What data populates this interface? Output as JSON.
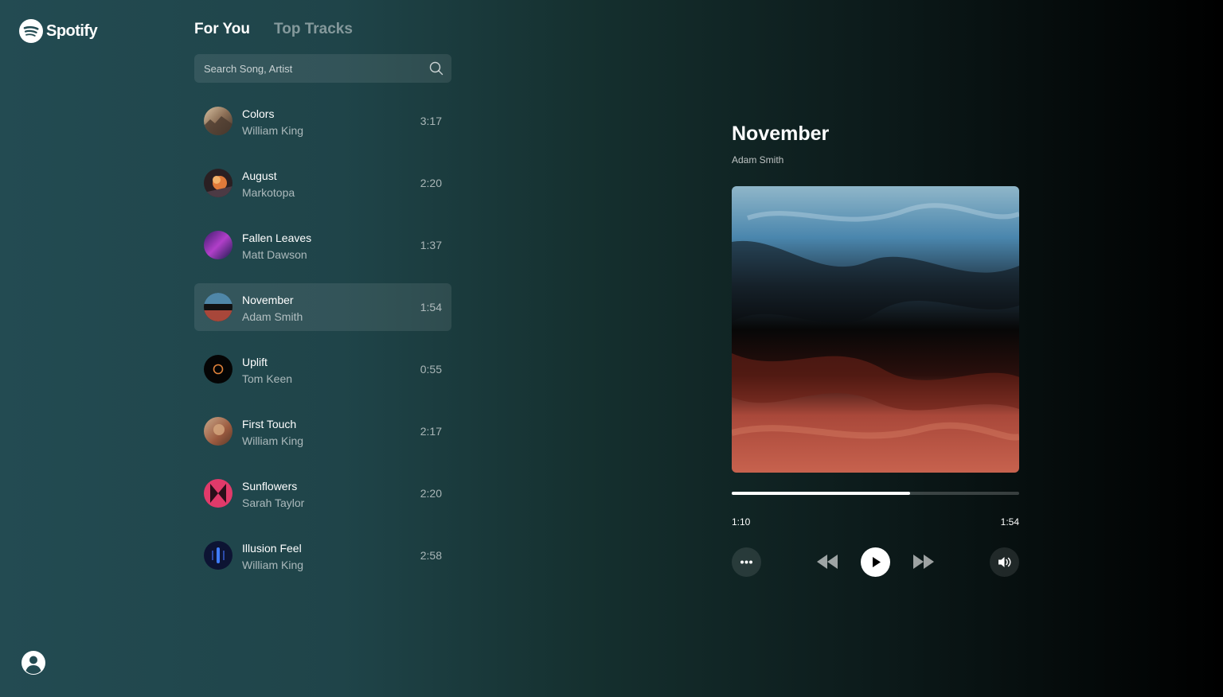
{
  "brand": {
    "name": "Spotify"
  },
  "tabs": [
    {
      "label": "For You",
      "active": true
    },
    {
      "label": "Top Tracks",
      "active": false
    }
  ],
  "search": {
    "placeholder": "Search Song, Artist",
    "value": ""
  },
  "tracks": [
    {
      "title": "Colors",
      "artist": "William King",
      "duration": "3:17",
      "thumb": "warm-landscape",
      "active": false
    },
    {
      "title": "August",
      "artist": "Markotopa",
      "duration": "2:20",
      "thumb": "orange-burst",
      "active": false
    },
    {
      "title": "Fallen Leaves",
      "artist": "Matt Dawson",
      "duration": "1:37",
      "thumb": "purple-gradient",
      "active": false
    },
    {
      "title": "November",
      "artist": "Adam Smith",
      "duration": "1:54",
      "thumb": "blue-red-fluid",
      "active": true
    },
    {
      "title": "Uplift",
      "artist": "Tom Keen",
      "duration": "0:55",
      "thumb": "black-orange-ring",
      "active": false
    },
    {
      "title": "First Touch",
      "artist": "William King",
      "duration": "2:17",
      "thumb": "warm-portrait",
      "active": false
    },
    {
      "title": "Sunflowers",
      "artist": "Sarah Taylor",
      "duration": "2:20",
      "thumb": "pink-red-shape",
      "active": false
    },
    {
      "title": "Illusion Feel",
      "artist": "William King",
      "duration": "2:58",
      "thumb": "blue-neon",
      "active": false
    }
  ],
  "now_playing": {
    "title": "November",
    "artist": "Adam Smith",
    "elapsed": "1:10",
    "total": "1:54",
    "progress": 0.62
  },
  "controls": {
    "icons": [
      "more-icon",
      "previous-icon",
      "play-icon",
      "next-icon",
      "volume-icon"
    ]
  },
  "colors": {
    "accent": "#ffffff",
    "active_row": "rgba(255,255,255,0.09)",
    "muted_text": "rgba(255,255,255,0.62)"
  }
}
